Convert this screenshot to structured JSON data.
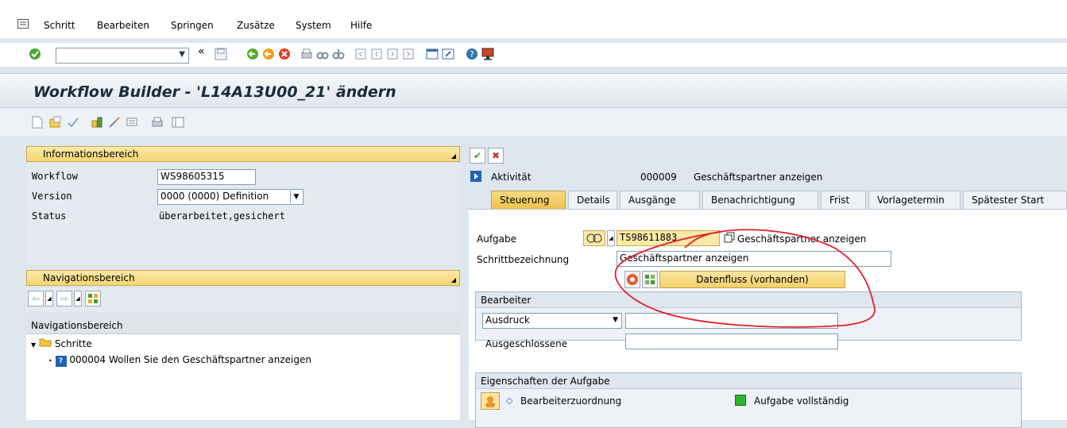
{
  "menu": {
    "items": [
      "Schritt",
      "Bearbeiten",
      "Springen",
      "Zusätze",
      "System",
      "Hilfe"
    ]
  },
  "toolbar": {
    "command_value": "",
    "icons": [
      "enter-icon",
      "back-double-icon",
      "save-icon",
      "back-icon",
      "exit-icon",
      "cancel-icon",
      "print-icon",
      "find-icon",
      "find-next-icon",
      "first-page-icon",
      "prev-page-icon",
      "next-page-icon",
      "last-page-icon",
      "new-session-icon",
      "shortcut-icon",
      "help-icon",
      "customize-icon"
    ]
  },
  "title": "Workflow Builder - 'L14A13U00_21' ändern",
  "info": {
    "header": "Informationsbereich",
    "workflow_label": "Workflow",
    "workflow_value": "WS98605315",
    "version_label": "Version",
    "version_value": "0000 (0000) Definition",
    "status_label": "Status",
    "status_value": "überarbeitet,gesichert"
  },
  "nav": {
    "header": "Navigationsbereich",
    "tree_header": "Navigationsbereich",
    "root": "Schritte",
    "step_id": "000004",
    "step_text": "Wollen Sie den Geschäftspartner anzeigen"
  },
  "detail": {
    "type_label": "Aktivität",
    "step_number": "000009",
    "step_title": "Geschäftspartner anzeigen",
    "tabs": [
      "Steuerung",
      "Details",
      "Ausgänge",
      "Benachrichtigung",
      "Frist",
      "Vorlagetermin",
      "Spätester Start"
    ],
    "task_label": "Aufgabe",
    "task_value": "TS98611883",
    "task_desc": "Geschäftspartner anzeigen",
    "stepname_label": "Schrittbezeichnung",
    "stepname_value": "Geschäftspartner anzeigen",
    "dataflow_button": "Datenfluss (vorhanden)",
    "agents_group": "Bearbeiter",
    "expression_select": "Ausdruck",
    "expression_value": "",
    "excluded_label": "Ausgeschlossene",
    "excluded_value": "",
    "properties_group": "Eigenschaften der Aufgabe",
    "agent_assign": "Bearbeiterzuordnung",
    "task_complete": "Aufgabe vollständig",
    "colors": {
      "complete": "#2db52d",
      "annotation": "#e0202a"
    }
  }
}
